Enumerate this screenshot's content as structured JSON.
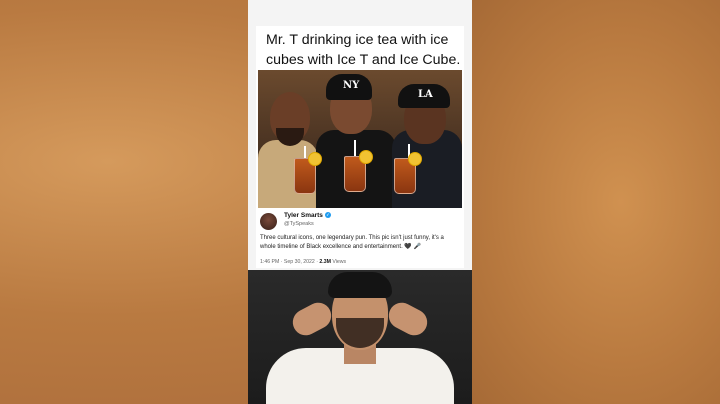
{
  "meme": {
    "caption": "Mr. T drinking ice tea with ice cubes with Ice T and Ice Cube.",
    "caps": [
      "NY",
      "LA"
    ]
  },
  "tweet": {
    "name": "Tyler Smarts",
    "handle": "@TySpeaks",
    "text": "Three cultural icons, one legendary pun. This pic isn't just funny, it's a whole timeline of Black excellence and entertainment. 🖤 🎤",
    "timestamp": "1:46 PM · Sep 30, 2022 · ",
    "views_count": "2.3M",
    "views_label": " Views"
  },
  "colors": {
    "background": "#c98a4e",
    "verified": "#1d9bf0"
  },
  "icons": {
    "verified": "verified-badge-icon"
  }
}
